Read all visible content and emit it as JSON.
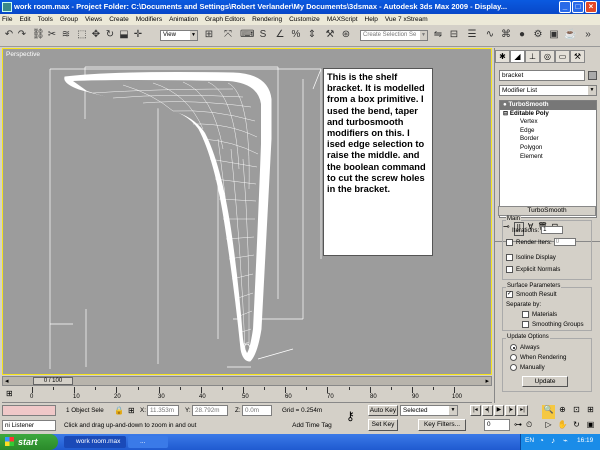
{
  "window": {
    "title": "work room.max    - Project Folder: C:\\Documents and Settings\\Robert Verlander\\My Documents\\3dsmax    - Autodesk 3ds Max  2009    - Display..."
  },
  "menu": [
    "File",
    "Edit",
    "Tools",
    "Group",
    "Views",
    "Create",
    "Modifiers",
    "Animation",
    "Graph Editors",
    "Rendering",
    "Customize",
    "MAXScript",
    "Help",
    "Vue 7 xStream"
  ],
  "toolbar": {
    "reference_coord": "View",
    "selection_set_placeholder": "Create Selection Se"
  },
  "viewport": {
    "label": "Perspective",
    "background_color": "#9c9c9c",
    "border_color": "#f5e31b"
  },
  "note": {
    "text": "This is the shelf bracket. It is modelled  from a box primitive. I used the bend, taper and turbosmooth modifiers on this. I ised edge selection to raise the middle. and the boolean command to cut the screw holes in the bracket."
  },
  "command_panel": {
    "object_name": "bracket",
    "modifier_list": "Modifier List",
    "stack": [
      {
        "label": "TurboSmooth",
        "level": 0,
        "selected": true
      },
      {
        "label": "Editable Poly",
        "level": 0,
        "selected": false
      },
      {
        "label": "Vertex",
        "level": 1
      },
      {
        "label": "Edge",
        "level": 1
      },
      {
        "label": "Border",
        "level": 1
      },
      {
        "label": "Polygon",
        "level": 1
      },
      {
        "label": "Element",
        "level": 1
      }
    ],
    "turbosmooth": {
      "header": "TurboSmooth",
      "main_label": "Main",
      "iterations_label": "Iterations:",
      "iterations": "1",
      "render_iters_label": "Render Iters:",
      "render_iters": "0",
      "isoline_label": "Isoline Display",
      "explicit_normals_label": "Explicit Normals",
      "surface_label": "Surface Parameters",
      "smooth_result_label": "Smooth Result",
      "separate_by_label": "Separate by:",
      "materials_label": "Materials",
      "smoothing_groups_label": "Smoothing Groups",
      "update_label": "Update Options",
      "always_label": "Always",
      "when_rendering_label": "When Rendering",
      "manually_label": "Manually",
      "update_button": "Update"
    }
  },
  "timeline": {
    "frame_display": "0 / 100",
    "ticks": [
      "0",
      "10",
      "20",
      "30",
      "40",
      "50",
      "60",
      "70",
      "80",
      "90",
      "100"
    ]
  },
  "status": {
    "listener": "ni Listener",
    "selected": "1 Object Sele",
    "x_label": "X:",
    "x": "11.353m",
    "y_label": "Y:",
    "y": "28.792m",
    "z_label": "Z:",
    "z": "0.0m",
    "grid": "Grid = 0.254m",
    "prompt": "Click and drag up-and-down to zoom in and out",
    "add_time_tag": "Add Time Tag",
    "auto_key": "Auto Key",
    "selected_dd": "Selected",
    "set_key": "Set Key",
    "key_filters": "Key Filters...",
    "frame": "0"
  },
  "taskbar": {
    "start": "start",
    "task1": "work room.max",
    "task2": "...",
    "lang": "EN",
    "clock": "16:19"
  }
}
